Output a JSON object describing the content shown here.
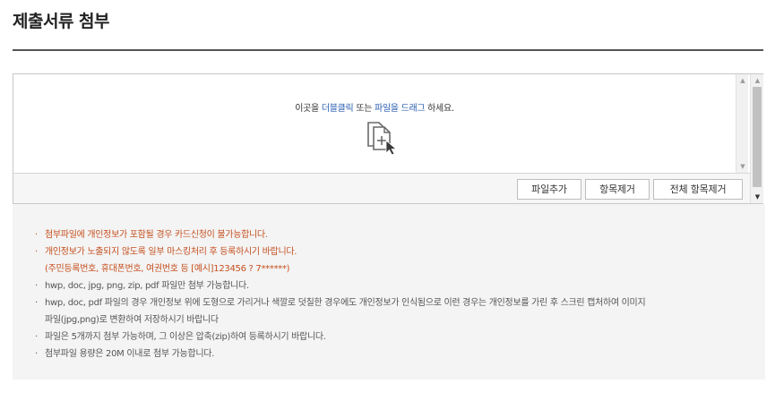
{
  "page": {
    "title": "제출서류 첨부"
  },
  "dropzone": {
    "hint_pre": "이곳을 ",
    "hint_link1": "더블클릭",
    "hint_mid": " 또는 ",
    "hint_link2": "파일을 드래그",
    "hint_post": " 하세요.",
    "icon": "file-add-cursor-icon"
  },
  "buttons": {
    "add": "파일추가",
    "remove": "항목제거",
    "remove_all": "전체 항목제거"
  },
  "notice": {
    "items": [
      {
        "text": "첨부파일에 개인정보가 포함될 경우 카드신청이 불가능합니다.",
        "style": "warn"
      },
      {
        "text": "개인정보가 노출되지 않도록 일부 마스킹처리 후 등록하시기 바랍니다.",
        "style": "warn"
      },
      {
        "text": "(주민등록번호, 휴대폰번호, 여권번호 등 [예시]123456 ? 7******)",
        "style": "warn-cont"
      },
      {
        "text": "hwp, doc, jpg, png, zip, pdf 파일만 첨부 가능합니다.",
        "style": "normal"
      },
      {
        "text": "hwp, doc, pdf 파일의 경우 개인정보 위에 도형으로 가리거나 색깔로 덧칠한 경우에도 개인정보가 인식됨으로 이런 경우는 개인정보를 가린 후 스크린 캡처하여 이미지",
        "style": "normal"
      },
      {
        "text": "파일(jpg,png)로 변환하여 저장하시기 바랍니다",
        "style": "cont"
      },
      {
        "text": "파일은 5개까지 첨부 가능하며, 그 이상은 압축(zip)하여 등록하시기 바랍니다.",
        "style": "normal"
      },
      {
        "text": "첨부파일 용량은 20M 이내로 첨부 가능합니다.",
        "style": "normal"
      }
    ]
  },
  "colors": {
    "warning": "#c5501f",
    "link": "#2a5db0",
    "notice_bg": "#f4f4f4"
  }
}
